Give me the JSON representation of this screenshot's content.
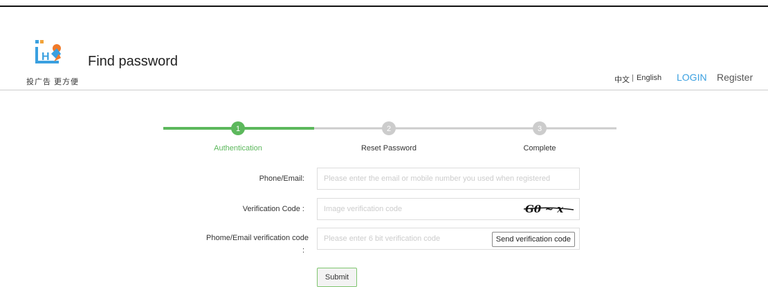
{
  "header": {
    "logo_tagline": "投广告 更方便",
    "title": "Find password",
    "lang_zh": "中文",
    "lang_sep": "|",
    "lang_en": "English",
    "login": "LOGIN",
    "register": "Register"
  },
  "steps": [
    {
      "number": "1",
      "label": "Authentication",
      "active": true
    },
    {
      "number": "2",
      "label": "Reset Password",
      "active": false
    },
    {
      "number": "3",
      "label": "Complete",
      "active": false
    }
  ],
  "form": {
    "phone_label": "Phone/Email:",
    "phone_placeholder": "Please enter the email or mobile number you used when registered",
    "verify_label": "Verification Code :",
    "verify_placeholder": "Image verification code",
    "captcha_text": "G0 ~ x",
    "code_label_line1": "Phome/Email verification code",
    "code_label_line2": ":",
    "code_placeholder": "Please enter 6 bit verification code",
    "send_button": "Send verification code",
    "submit": "Submit"
  },
  "colors": {
    "active_green": "#5cb85c",
    "inactive_gray": "#cccccc",
    "link_blue": "#3aa0e0"
  }
}
